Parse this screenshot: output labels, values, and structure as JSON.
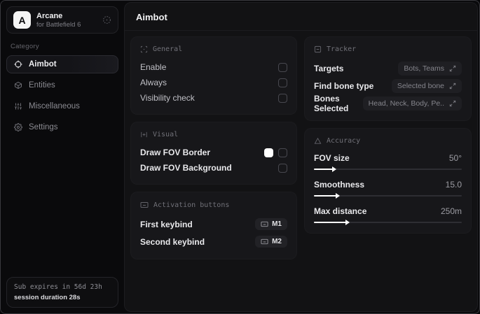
{
  "app": {
    "name": "Arcane",
    "subtitle": "for Battlefield 6",
    "logo_letter": "A"
  },
  "sidebar": {
    "category_label": "Category",
    "items": [
      {
        "label": "Aimbot",
        "icon": "crosshair-icon",
        "selected": true
      },
      {
        "label": "Entities",
        "icon": "box-icon",
        "selected": false
      },
      {
        "label": "Miscellaneous",
        "icon": "sliders-icon",
        "selected": false
      },
      {
        "label": "Settings",
        "icon": "gear-icon",
        "selected": false
      }
    ],
    "status": {
      "line1": "Sub expires in 56d 23h",
      "line2": "session duration 28s"
    }
  },
  "main": {
    "title": "Aimbot",
    "general": {
      "title": "General",
      "rows": [
        {
          "label": "Enable",
          "checked": false
        },
        {
          "label": "Always",
          "checked": false
        },
        {
          "label": "Visibility check",
          "checked": false
        }
      ]
    },
    "visual": {
      "title": "Visual",
      "rows": [
        {
          "label": "Draw FOV Border",
          "swatch": "#ffffff",
          "checked": false
        },
        {
          "label": "Draw FOV Background",
          "checked": false
        }
      ]
    },
    "activation": {
      "title": "Activation buttons",
      "rows": [
        {
          "label": "First keybind",
          "key": "M1"
        },
        {
          "label": "Second keybind",
          "key": "M2"
        }
      ]
    },
    "tracker": {
      "title": "Tracker",
      "rows": [
        {
          "label": "Targets",
          "value": "Bots, Teams"
        },
        {
          "label": "Find bone type",
          "value": "Selected bone"
        },
        {
          "label": "Bones Selected",
          "value": "Head, Neck, Body, Pe.."
        }
      ]
    },
    "accuracy": {
      "title": "Accuracy",
      "sliders": [
        {
          "label": "FOV size",
          "value": "50°",
          "percent": 13
        },
        {
          "label": "Smoothness",
          "value": "15.0",
          "percent": 15
        },
        {
          "label": "Max distance",
          "value": "250m",
          "percent": 22
        }
      ]
    }
  },
  "colors": {
    "accent": "#ffffff",
    "panel": "#121214",
    "card": "#17171a"
  }
}
